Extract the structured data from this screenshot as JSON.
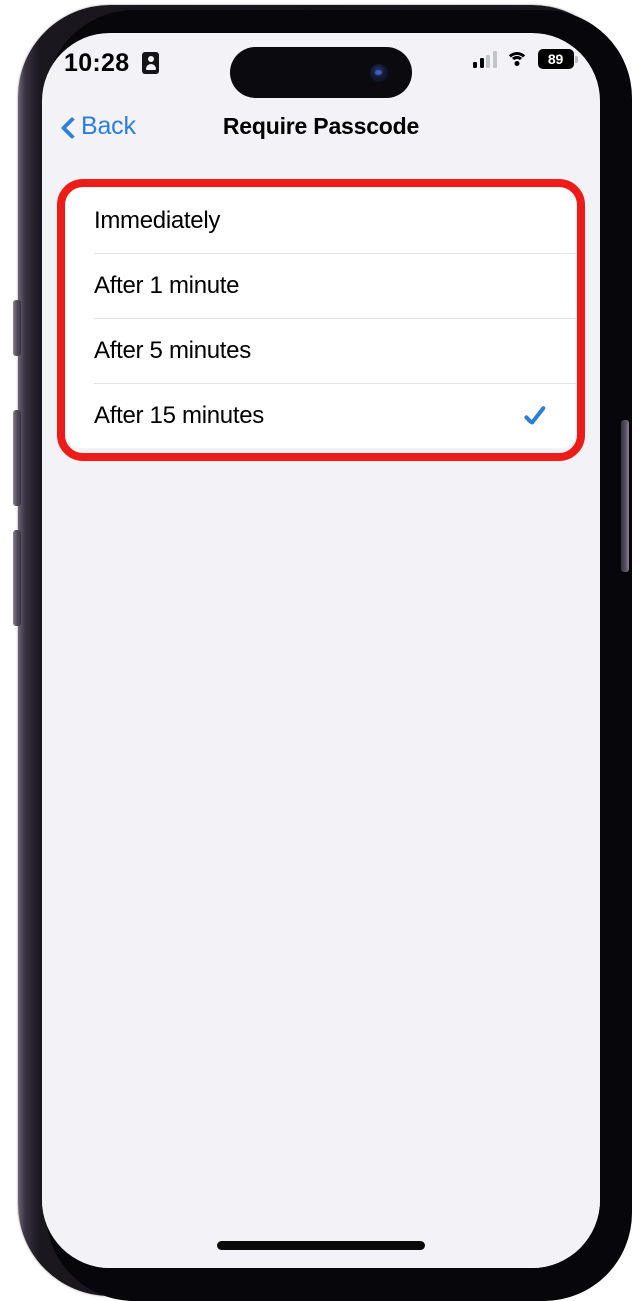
{
  "status_bar": {
    "time": "10:28",
    "lock_badge_icon": "id-badge-icon",
    "cellular_icon": "cellular-signal-icon",
    "cellular_bars_filled": 2,
    "cellular_bars_total": 4,
    "wifi_icon": "wifi-icon",
    "battery_icon": "battery-icon",
    "battery_level": "89"
  },
  "nav_bar": {
    "back_icon": "chevron-left-icon",
    "back_label": "Back",
    "title": "Require Passcode"
  },
  "options": {
    "rows": [
      {
        "label": "Immediately",
        "selected": false
      },
      {
        "label": "After 1 minute",
        "selected": false
      },
      {
        "label": "After 5 minutes",
        "selected": false
      },
      {
        "label": "After 15 minutes",
        "selected": true
      }
    ]
  },
  "annotation": {
    "shape": "rounded-rectangle-highlight",
    "color": "#ee1c18"
  },
  "colors": {
    "accent_blue": "#2b7de0",
    "check_blue": "#2b7fd4",
    "screen_background": "#f2f2f7",
    "card_background": "#ffffff",
    "separator": "#e3e3e6",
    "annotation_red": "#ee1c18"
  },
  "home_indicator": "home-indicator"
}
